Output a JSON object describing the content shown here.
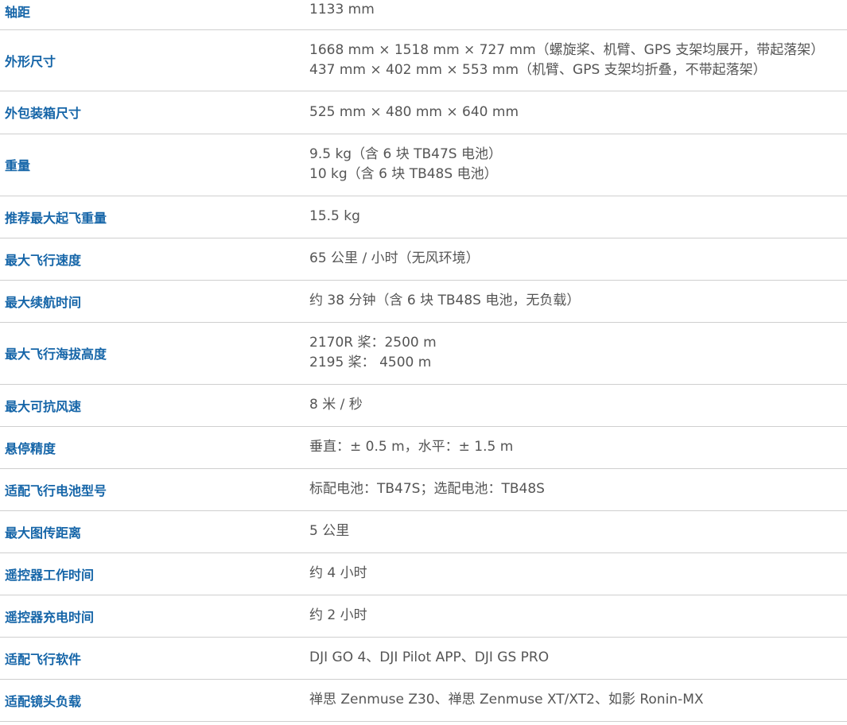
{
  "specs": [
    {
      "label": "轴距",
      "values": [
        "1133 mm"
      ]
    },
    {
      "label": "外形尺寸",
      "values": [
        "1668 mm × 1518 mm × 727 mm（螺旋桨、机臂、GPS 支架均展开，带起落架）",
        "437 mm × 402 mm × 553 mm（机臂、GPS 支架均折叠，不带起落架）"
      ]
    },
    {
      "label": "外包装箱尺寸",
      "values": [
        "525 mm × 480 mm × 640 mm"
      ]
    },
    {
      "label": "重量",
      "values": [
        "9.5 kg（含 6 块 TB47S 电池）",
        "10 kg（含 6 块 TB48S 电池）"
      ]
    },
    {
      "label": "推荐最大起飞重量",
      "values": [
        "15.5 kg"
      ]
    },
    {
      "label": "最大飞行速度",
      "values": [
        "65 公里 / 小时（无风环境）"
      ]
    },
    {
      "label": "最大续航时间",
      "values": [
        "约 38 分钟（含 6 块 TB48S 电池，无负载）"
      ]
    },
    {
      "label": "最大飞行海拔高度",
      "values": [
        "2170R 桨：2500 m",
        "2195 桨： 4500 m"
      ]
    },
    {
      "label": "最大可抗风速",
      "values": [
        "8 米 / 秒"
      ]
    },
    {
      "label": "悬停精度",
      "values": [
        "垂直：± 0.5 m，水平：± 1.5 m"
      ]
    },
    {
      "label": "适配飞行电池型号",
      "values": [
        "标配电池：TB47S；选配电池：TB48S"
      ]
    },
    {
      "label": "最大图传距离",
      "values": [
        "5 公里"
      ]
    },
    {
      "label": "遥控器工作时间",
      "values": [
        "约 4 小时"
      ]
    },
    {
      "label": "遥控器充电时间",
      "values": [
        "约 2 小时"
      ]
    },
    {
      "label": "适配飞行软件",
      "values": [
        "DJI GO 4、DJI Pilot APP、DJI GS PRO"
      ]
    },
    {
      "label": "适配镜头负载",
      "values": [
        "禅思 Zenmuse Z30、禅思 Zenmuse XT/XT2、如影 Ronin-MX"
      ]
    }
  ]
}
